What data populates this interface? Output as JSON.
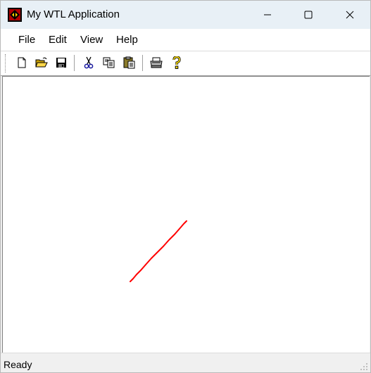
{
  "window": {
    "title": "My WTL Application",
    "icon": "app-icon"
  },
  "caption_buttons": [
    {
      "name": "minimize",
      "icon": "minimize-icon"
    },
    {
      "name": "maximize",
      "icon": "maximize-icon"
    },
    {
      "name": "close",
      "icon": "close-icon"
    }
  ],
  "menu": {
    "items": [
      "File",
      "Edit",
      "View",
      "Help"
    ]
  },
  "toolbar": {
    "buttons": [
      {
        "name": "new",
        "icon": "new-document-icon"
      },
      {
        "name": "open",
        "icon": "open-folder-icon"
      },
      {
        "name": "save",
        "icon": "save-disk-icon"
      },
      {
        "name": "cut",
        "icon": "scissors-icon"
      },
      {
        "name": "copy",
        "icon": "copy-icon"
      },
      {
        "name": "paste",
        "icon": "paste-clipboard-icon"
      },
      {
        "name": "print",
        "icon": "printer-icon"
      },
      {
        "name": "help",
        "icon": "help-question-icon"
      }
    ]
  },
  "canvas": {
    "stroke_color": "#ff0000"
  },
  "status": {
    "text": "Ready"
  },
  "colors": {
    "titlebar": "#e8f0f6",
    "chrome": "#f0f0f0",
    "line": "#ff0000"
  }
}
